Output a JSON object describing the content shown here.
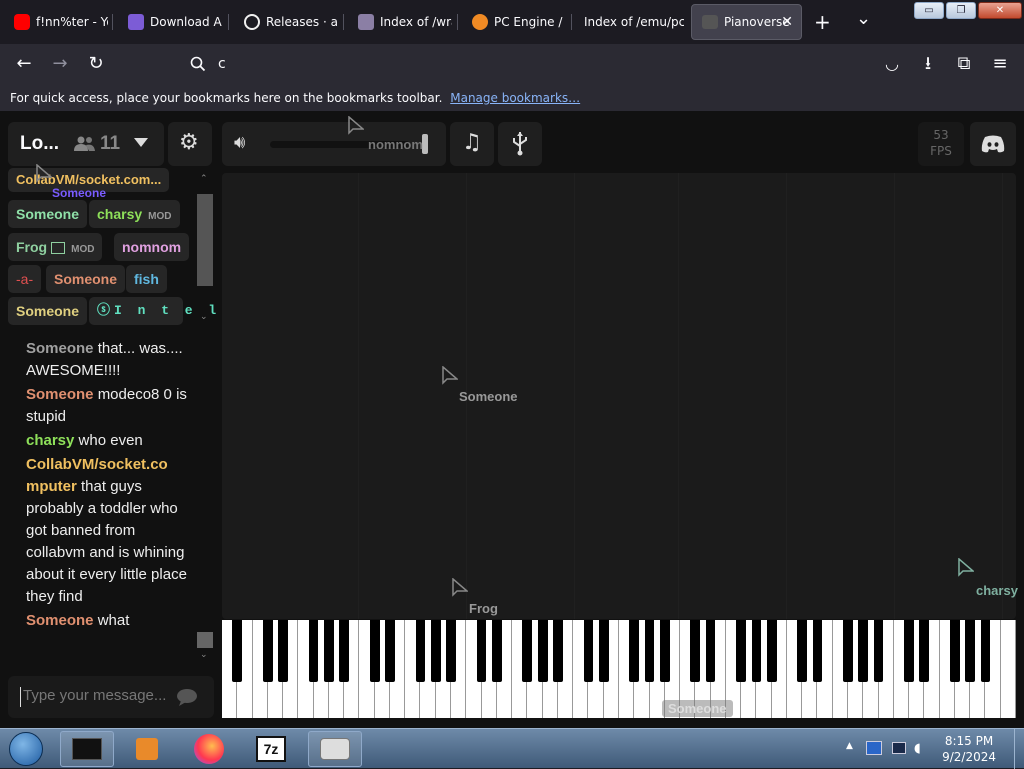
{
  "tabs": [
    {
      "title": "f!nn%ter - Yo",
      "favicon_color": "#ff0000"
    },
    {
      "title": "Download Ad",
      "favicon_color": "#7c5cd6"
    },
    {
      "title": "Releases · are",
      "favicon_color": "#f0f0f0"
    },
    {
      "title": "Index of /wra",
      "favicon_color": "#8b7fa5"
    },
    {
      "title": "PC Engine / T",
      "favicon_color": "#f08a24"
    },
    {
      "title": "Index of /emu/pc",
      "favicon_color": ""
    },
    {
      "title": "Pianoverse",
      "favicon_color": "#555555",
      "close": "✕"
    }
  ],
  "new_tab_label": "+",
  "tab_list_label": "⌄",
  "window_controls": {
    "minimize": "▭",
    "restore": "❐",
    "close": "✕"
  },
  "nav": {
    "back": "←",
    "forward": "→",
    "reload": "↻",
    "url": "c",
    "pocket": "◡",
    "download": "⭳",
    "extensions": "⧉",
    "menu": "≡"
  },
  "bookmarks_bar": {
    "text": "For quick access, place your bookmarks here on the bookmarks toolbar.",
    "link": "Manage bookmarks…"
  },
  "room": {
    "name": "Lo...",
    "user_count": "11"
  },
  "toolbar": {
    "volume_user": "nomnom",
    "fps_value": "53",
    "fps_label": "FPS"
  },
  "users": [
    {
      "name": "CollabVM/socket.com...",
      "color": "#f0c060"
    },
    {
      "name": "Someone",
      "color": "#8fe0a8"
    },
    {
      "name": "charsy",
      "color": "#8ee05a",
      "badge": "MOD"
    },
    {
      "name": "Frog",
      "color": "#8fd0a0",
      "badge": "MOD"
    },
    {
      "name": "nomnom",
      "color": "#e0a0e0"
    },
    {
      "name": "-a-",
      "color": "#e05050"
    },
    {
      "name": "Someone",
      "color": "#e09070"
    },
    {
      "name": "fish",
      "color": "#60b8e0"
    },
    {
      "name": "Someone",
      "color": "#e0d080"
    },
    {
      "name": "ⓢI n t e l",
      "color": "#60e0c0"
    }
  ],
  "overlay_label": "Someone",
  "chat": [
    {
      "user": "Someone",
      "color": "#a0a0a0",
      "text": "that... was.... AWESOME!!!!"
    },
    {
      "user": "Someone",
      "color": "#e09070",
      "text": "modeco8 0 is stupid"
    },
    {
      "user": "charsy",
      "color": "#8ee05a",
      "text": "who even"
    },
    {
      "user": "CollabVM/socket.co mputer",
      "color": "#f0c060",
      "text": "that guys probably a toddler who got banned from collabvm and is whining about it every little place they find"
    },
    {
      "user": "Someone",
      "color": "#e09070",
      "text": "what"
    }
  ],
  "chat_input": {
    "placeholder": "Type your message..."
  },
  "cursors": [
    {
      "label": "Someone",
      "color": "#999999"
    },
    {
      "label": "Frog",
      "color": "#999999"
    },
    {
      "label": "charsy",
      "color": "#7fb0a0"
    },
    {
      "label": "Someone",
      "color": "#999999"
    }
  ],
  "taskbar": {
    "time": "8:15 PM",
    "date": "9/2/2024",
    "app_7z": "7z"
  }
}
